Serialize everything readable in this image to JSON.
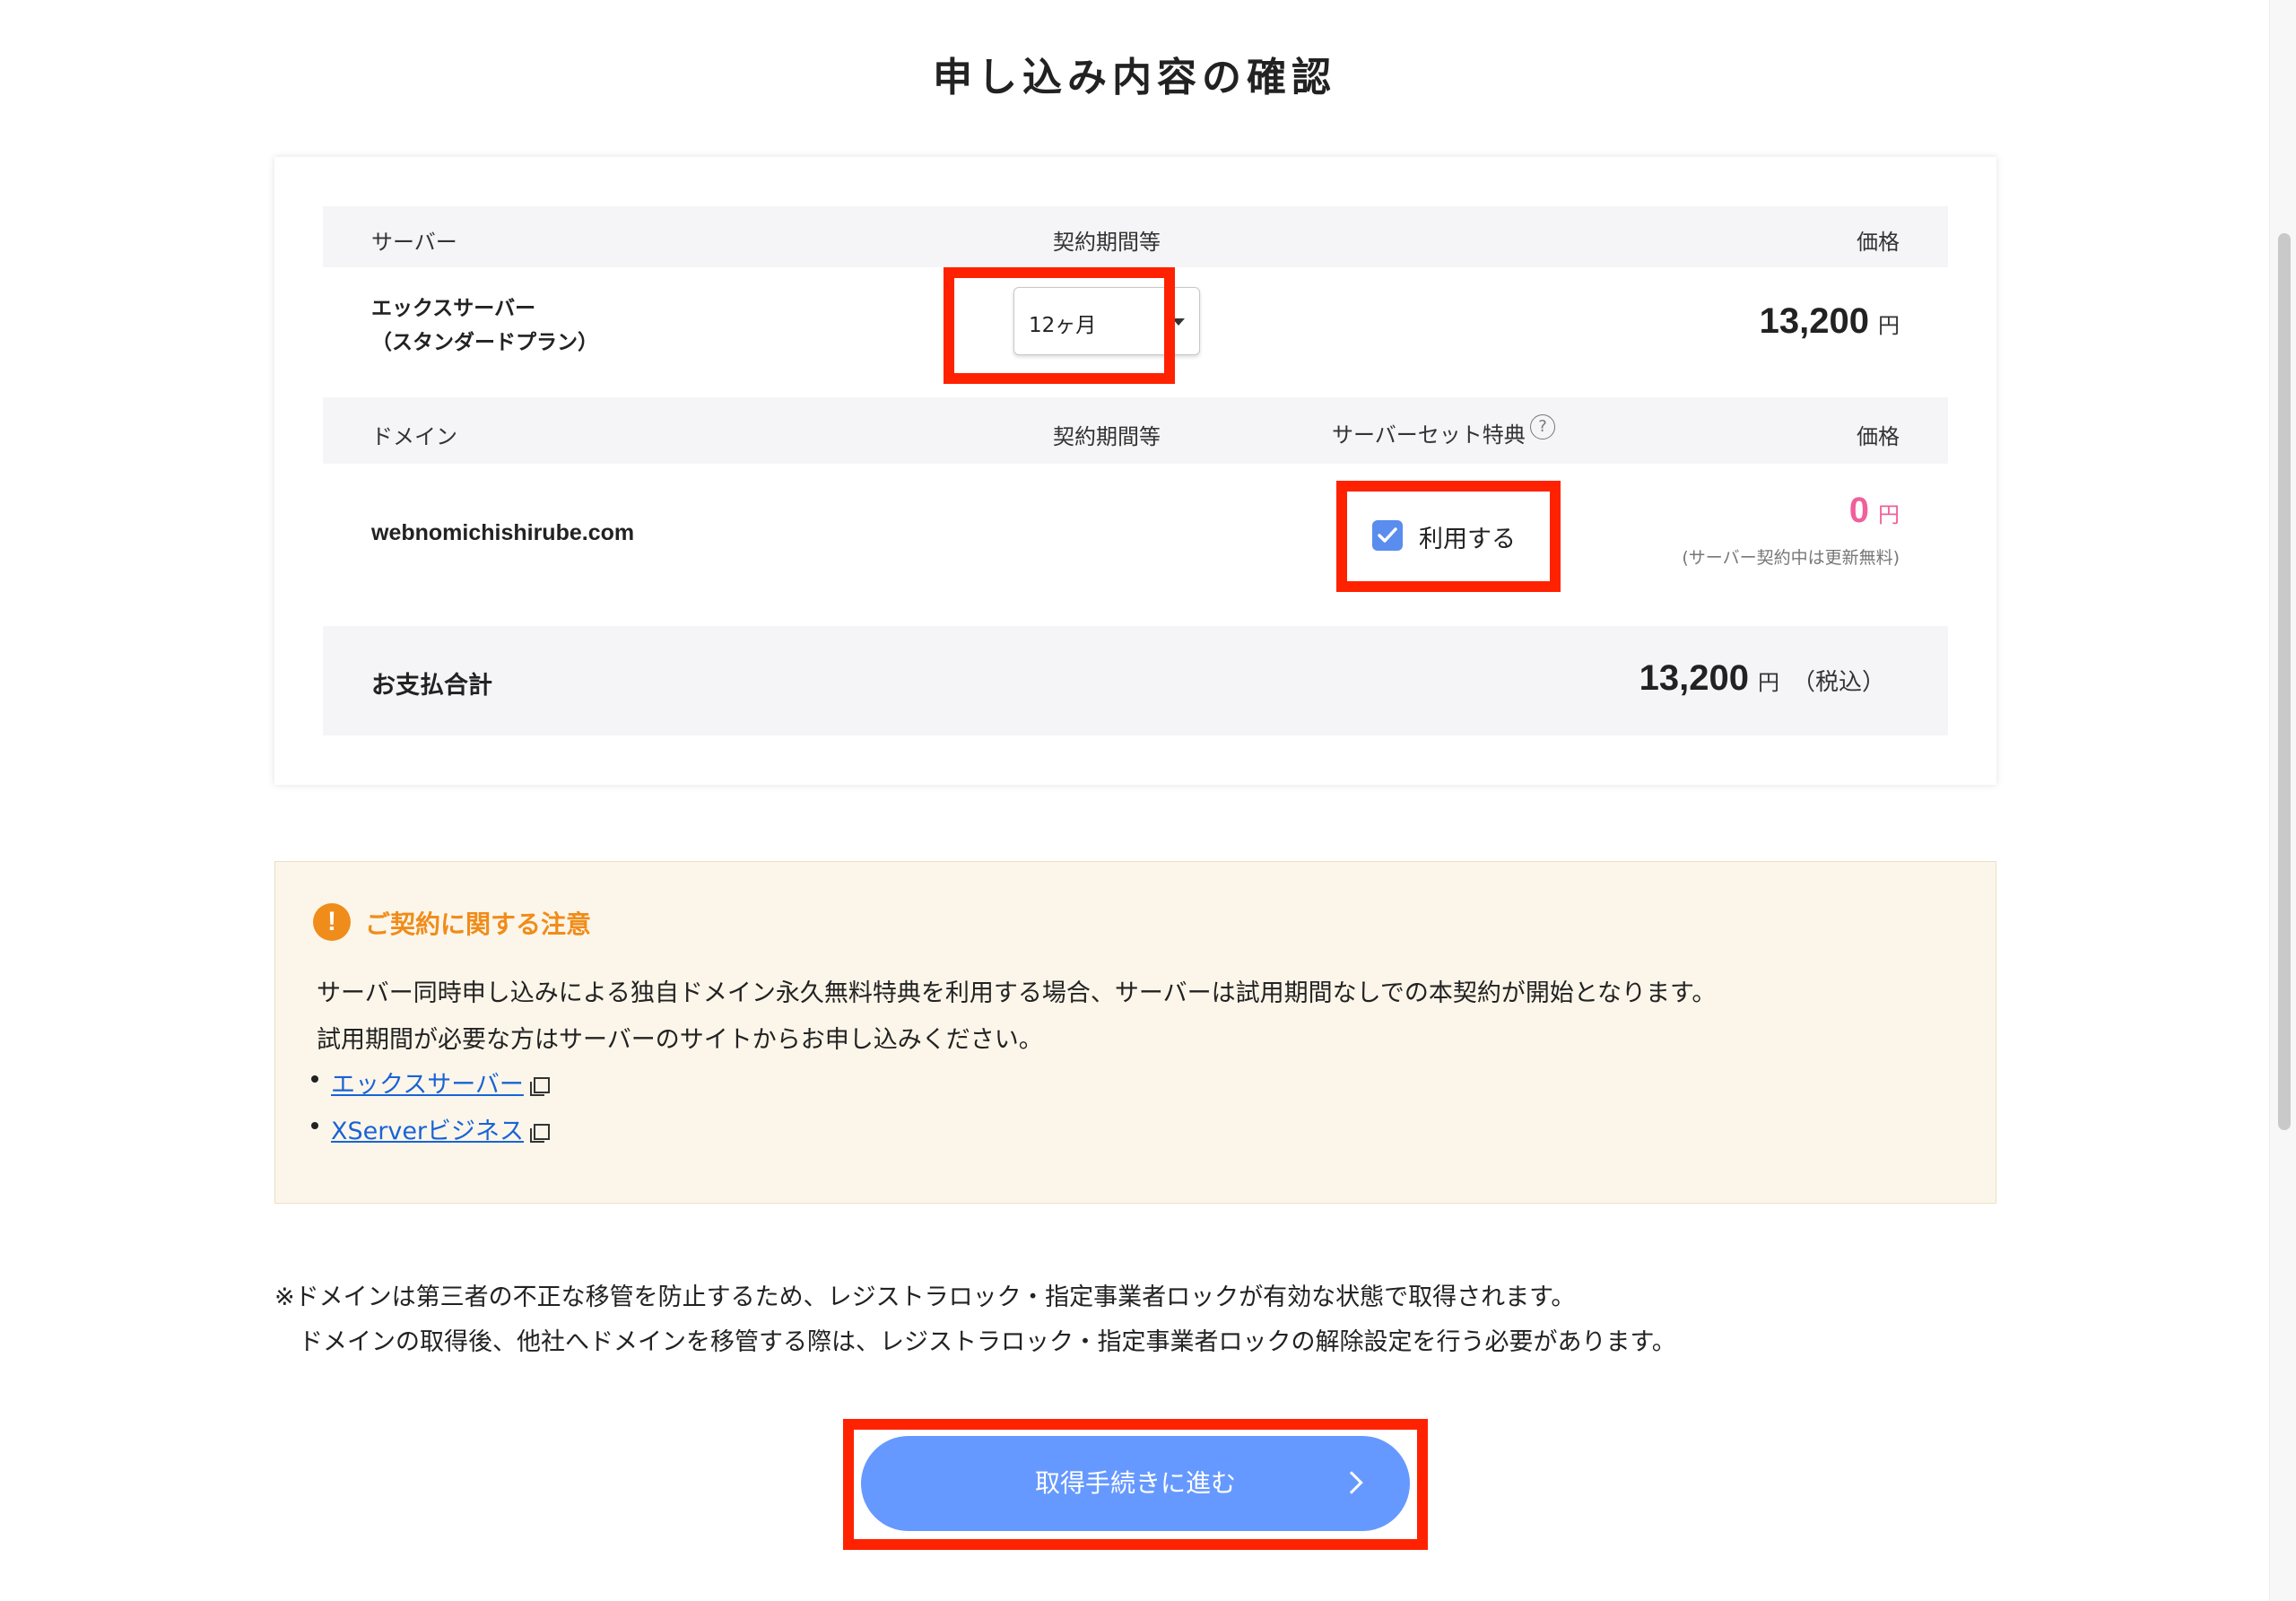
{
  "page": {
    "title": "申し込み内容の確認"
  },
  "server_section": {
    "header": {
      "col_server": "サーバー",
      "col_period": "契約期間等",
      "col_price": "価格"
    },
    "row": {
      "name_line1": "エックスサーバー",
      "name_line2": "（スタンダードプラン）",
      "period_selected": "12ヶ月",
      "price": "13,200",
      "currency": "円"
    }
  },
  "domain_section": {
    "header": {
      "col_domain": "ドメイン",
      "col_period": "契約期間等",
      "col_benefit": "サーバーセット特典",
      "help_icon": "question-circle-icon",
      "col_price": "価格"
    },
    "row": {
      "domain": "webnomichishirube.com",
      "benefit_checked": true,
      "benefit_label": "利用する",
      "price": "0",
      "currency": "円",
      "price_note": "(サーバー契約中は更新無料)"
    }
  },
  "total": {
    "label": "お支払合計",
    "amount": "13,200",
    "currency": "円",
    "tax_note": "（税込）"
  },
  "notice": {
    "icon": "exclamation-circle-icon",
    "title": "ご契約に関する注意",
    "line1": "サーバー同時申し込みによる独自ドメイン永久無料特典を利用する場合、サーバーは試用期間なしでの本契約が開始となります。",
    "line2": "試用期間が必要な方はサーバーのサイトからお申し込みください。",
    "links": [
      {
        "label": "エックスサーバー"
      },
      {
        "label": "XServerビジネス"
      }
    ]
  },
  "footnote": {
    "line1": "※ドメインは第三者の不正な移管を防止するため、レジストラロック・指定事業者ロックが有効な状態で取得されます。",
    "line2": "　ドメインの取得後、他社へドメインを移管する際は、レジストラロック・指定事業者ロックの解除設定を行う必要があります。"
  },
  "cta": {
    "label": "取得手続きに進む"
  },
  "colors": {
    "accent_button": "#6699ff",
    "highlight_red": "#ff2200",
    "price_pink": "#f0609a",
    "notice_orange": "#f08c1a",
    "link_blue": "#1a63d6"
  }
}
